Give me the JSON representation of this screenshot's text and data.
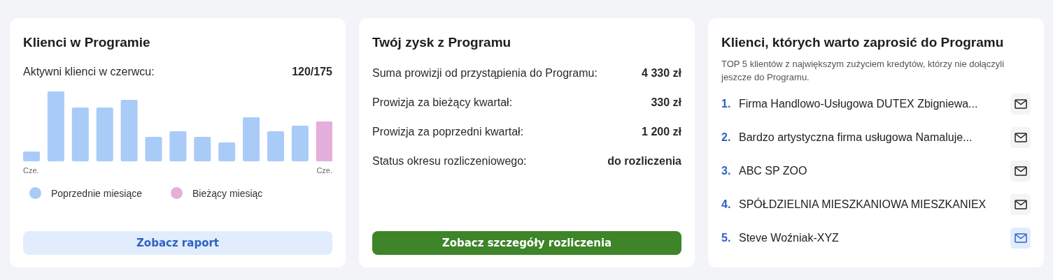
{
  "cards": [
    {
      "kind": "chart",
      "title": "Klienci w Programie",
      "stat_label": "Aktywni klienci w czerwcu:",
      "stat_value": "120/175",
      "axis_start": "Cze.",
      "axis_end": "Cze.",
      "legend": [
        {
          "label": "Poprzednie miesiące",
          "color": "#a9cbf8"
        },
        {
          "label": "Bieżący miesiąc",
          "color": "#e4afdb"
        }
      ],
      "button": {
        "label": "Zobacz raport",
        "kind": "secondary"
      }
    },
    {
      "kind": "stats",
      "title": "Twój zysk z Programu",
      "rows": [
        {
          "label": "Suma prowizji od przystąpienia do Programu:",
          "value": "4 330 zł"
        },
        {
          "label": "Prowizja za bieżący kwartał:",
          "value": "330 zł"
        },
        {
          "label": "Prowizja za poprzedni kwartał:",
          "value": "1 200 zł"
        },
        {
          "label": "Status okresu rozliczeniowego:",
          "value": "do rozliczenia"
        }
      ],
      "button": {
        "label": "Zobacz szczegóły rozliczenia",
        "kind": "primary"
      }
    },
    {
      "kind": "list",
      "title": "Klienci, których warto zaprosić do Programu",
      "subtitle": "TOP 5 klientów z największym zużyciem kredytów, którzy nie dołączyli jeszcze do Programu.",
      "items": [
        {
          "number": "1.",
          "name": "Firma Handlowo-Usługowa DUTEX Zbigniewa...",
          "selected": false
        },
        {
          "number": "2.",
          "name": "Bardzo artystyczna firma usługowa Namaluje...",
          "selected": false
        },
        {
          "number": "3.",
          "name": "ABC SP ZOO",
          "selected": false
        },
        {
          "number": "4.",
          "name": "SPÓŁDZIELNIA MIESZKANIOWA MIESZKANIEX",
          "selected": false
        },
        {
          "number": "5.",
          "name": "Steve Woźniak-XYZ",
          "selected": true
        }
      ]
    }
  ]
}
